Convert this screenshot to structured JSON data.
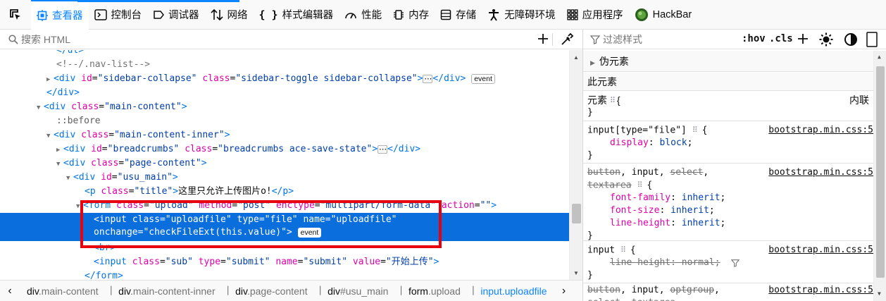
{
  "toolbar": {
    "tabs": [
      {
        "label": "查看器",
        "icon": "inspector-icon"
      },
      {
        "label": "控制台",
        "icon": "console-icon"
      },
      {
        "label": "调试器",
        "icon": "debugger-icon"
      },
      {
        "label": "网络",
        "icon": "network-icon"
      },
      {
        "label": "样式编辑器",
        "icon": "style-editor-icon"
      },
      {
        "label": "性能",
        "icon": "performance-icon"
      },
      {
        "label": "内存",
        "icon": "memory-icon"
      },
      {
        "label": "存储",
        "icon": "storage-icon"
      },
      {
        "label": "无障碍环境",
        "icon": "accessibility-icon"
      },
      {
        "label": "应用程序",
        "icon": "application-icon"
      },
      {
        "label": "HackBar",
        "icon": "hackbar-icon"
      }
    ],
    "accent_color": "#0a84ff"
  },
  "markup": {
    "search_placeholder": "搜索 HTML",
    "lines": {
      "l0": "</ul>",
      "l1": "<!--/.nav-list-->",
      "l2a": "<div",
      "l2b": "id",
      "l2c": "\"sidebar-collapse\"",
      "l2d": "class",
      "l2e": "\"sidebar-toggle sidebar-collapse\"",
      "l2f": ">",
      "l2g": "</div>",
      "l3": "</div>",
      "l4a": "<div",
      "l4b": "class",
      "l4c": "\"main-content\"",
      "l4d": ">",
      "l5": "::before",
      "l6a": "<div",
      "l6b": "class",
      "l6c": "\"main-content-inner\"",
      "l6d": ">",
      "l7a": "<div",
      "l7b": "id",
      "l7c": "\"breadcrumbs\"",
      "l7d": "class",
      "l7e": "\"breadcrumbs ace-save-state\"",
      "l7f": ">",
      "l7g": "</div>",
      "l8a": "<div",
      "l8b": "class",
      "l8c": "\"page-content\"",
      "l8d": ">",
      "l9a": "<div",
      "l9b": "id",
      "l9c": "\"usu_main\"",
      "l9d": ">",
      "l10a": "<p",
      "l10b": "class",
      "l10c": "\"title\"",
      "l10d": ">",
      "l10e": "这里只允许上传图片o!",
      "l10f": "</p>",
      "l11a": "<form",
      "l11b": "class",
      "l11c": "\"upload\"",
      "l11d": "method",
      "l11e": "\"post\"",
      "l11f": "enctype",
      "l11g": "\"multipart/form-data\"",
      "l11h": "action",
      "l11i": "\"\"",
      "l11j": ">",
      "l12a": "<input",
      "l12b": "class",
      "l12c": "\"uploadfile\"",
      "l12d": "type",
      "l12e": "\"file\"",
      "l12f": "name",
      "l12g": "\"uploadfile\"",
      "l13a": "onchange",
      "l13b": "\"checkFileExt(this.value)\"",
      "l13c": ">",
      "l14": "<br>",
      "l15a": "<input",
      "l15b": "class",
      "l15c": "\"sub\"",
      "l15d": "type",
      "l15e": "\"submit\"",
      "l15f": "name",
      "l15g": "\"submit\"",
      "l15h": "value",
      "l15i": "\"开始上传\"",
      "l15j": ">",
      "l16": "</form>"
    },
    "event_badge": "event",
    "ellipsis_badge": "⋯",
    "highlight_color": "#e8000c"
  },
  "breadcrumbs": [
    {
      "tag": "div",
      "cls": ".main-content"
    },
    {
      "tag": "div",
      "cls": ".main-content-inner"
    },
    {
      "tag": "div",
      "cls": ".page-content"
    },
    {
      "tag": "div",
      "cls": "#usu_main"
    },
    {
      "tag": "form",
      "cls": ".upload"
    },
    {
      "tag": "input",
      "cls": ".uploadfile"
    }
  ],
  "rules": {
    "filter_placeholder": "过滤样式",
    "hov": ":hov",
    "cls": ".cls",
    "pseudo_title": "伪元素",
    "this_element": "此元素",
    "element_selector": "元素",
    "inline_label": "内联",
    "brace_open": "{",
    "brace_close": "}",
    "r1_selector": "input[type=\"file\"]",
    "r1_src": "bootstrap.min.css:5",
    "r1_p1n": "display",
    "r1_p1v": "block",
    "r2_s1": "button",
    "r2_s2": "input",
    "r2_s3": "select",
    "r2_s4": "textarea",
    "r2_src": "bootstrap.min.css:5",
    "r2_p1n": "font-family",
    "r2_p1v": "inherit",
    "r2_p2n": "font-size",
    "r2_p2v": "inherit",
    "r2_p3n": "line-height",
    "r2_p3v": "inherit",
    "r3_selector": "input",
    "r3_src": "bootstrap.min.css:5",
    "r3_p1n": "line-height",
    "r3_p1v": "normal",
    "r4_s1": "button",
    "r4_s2": "input",
    "r4_s3": "optgroup",
    "r4_s4": "select",
    "r4_s5": "textarea",
    "r4_src": "bootstrap.min.css:5"
  }
}
